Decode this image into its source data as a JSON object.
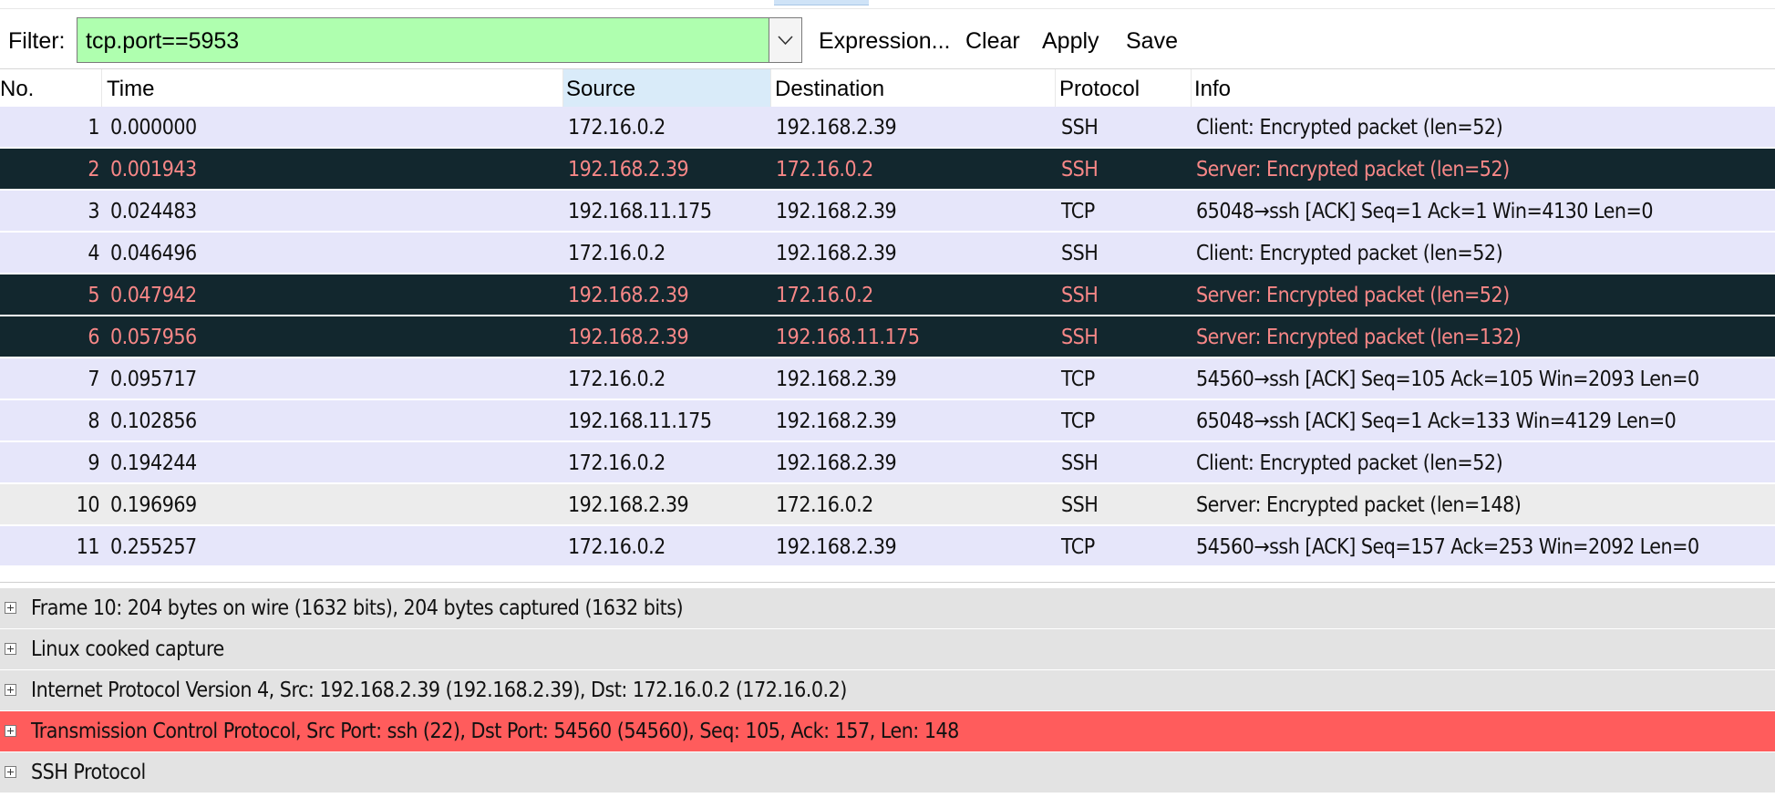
{
  "filter_bar": {
    "label": "Filter:",
    "value": "tcp.port==5953",
    "expression_label": "Expression...",
    "clear_label": "Clear",
    "apply_label": "Apply",
    "save_label": "Save",
    "valid_color": "#afffaf"
  },
  "packet_list": {
    "columns": [
      "No.",
      "Time",
      "Source",
      "Destination",
      "Protocol",
      "Info"
    ],
    "rows": [
      {
        "no": "1",
        "time": "0.000000",
        "source": "172.16.0.2",
        "destination": "192.168.2.39",
        "protocol": "SSH",
        "info": "Client: Encrypted packet (len=52)"
      },
      {
        "no": "2",
        "time": "0.001943",
        "source": "192.168.2.39",
        "destination": "172.16.0.2",
        "protocol": "SSH",
        "info": "Server: Encrypted packet (len=52)"
      },
      {
        "no": "3",
        "time": "0.024483",
        "source": "192.168.11.175",
        "destination": "192.168.2.39",
        "protocol": "TCP",
        "info": "65048→ssh [ACK] Seq=1 Ack=1 Win=4130 Len=0"
      },
      {
        "no": "4",
        "time": "0.046496",
        "source": "172.16.0.2",
        "destination": "192.168.2.39",
        "protocol": "SSH",
        "info": "Client: Encrypted packet (len=52)"
      },
      {
        "no": "5",
        "time": "0.047942",
        "source": "192.168.2.39",
        "destination": "172.16.0.2",
        "protocol": "SSH",
        "info": "Server: Encrypted packet (len=52)"
      },
      {
        "no": "6",
        "time": "0.057956",
        "source": "192.168.2.39",
        "destination": "192.168.11.175",
        "protocol": "SSH",
        "info": "Server: Encrypted packet (len=132)"
      },
      {
        "no": "7",
        "time": "0.095717",
        "source": "172.16.0.2",
        "destination": "192.168.2.39",
        "protocol": "TCP",
        "info": "54560→ssh [ACK] Seq=105 Ack=105 Win=2093 Len=0"
      },
      {
        "no": "8",
        "time": "0.102856",
        "source": "192.168.11.175",
        "destination": "192.168.2.39",
        "protocol": "TCP",
        "info": "65048→ssh [ACK] Seq=1 Ack=133 Win=4129 Len=0"
      },
      {
        "no": "9",
        "time": "0.194244",
        "source": "172.16.0.2",
        "destination": "192.168.2.39",
        "protocol": "SSH",
        "info": "Client: Encrypted packet (len=52)"
      },
      {
        "no": "10",
        "time": "0.196969",
        "source": "192.168.2.39",
        "destination": "172.16.0.2",
        "protocol": "SSH",
        "info": "Server: Encrypted packet (len=148)"
      },
      {
        "no": "11",
        "time": "0.255257",
        "source": "172.16.0.2",
        "destination": "192.168.2.39",
        "protocol": "TCP",
        "info": "54560→ssh [ACK] Seq=157 Ack=253 Win=2092 Len=0"
      }
    ]
  },
  "packet_details": [
    {
      "text": "Frame 10: 204 bytes on wire (1632 bits), 204 bytes captured (1632 bits)"
    },
    {
      "text": "Linux cooked capture"
    },
    {
      "text": "Internet Protocol Version 4, Src: 192.168.2.39 (192.168.2.39), Dst: 172.16.0.2 (172.16.0.2)"
    },
    {
      "text": "Transmission Control Protocol, Src Port: ssh (22), Dst Port: 54560 (54560), Seq: 105, Ack: 157, Len: 148"
    },
    {
      "text": "SSH Protocol"
    }
  ],
  "colors": {
    "row_light": "#e6e6fa",
    "row_dark": "#12272e",
    "row_dark_text": "#f78787",
    "row_selected": "#ececec",
    "detail_bg": "#e3e3e3",
    "detail_highlight": "#ff5c5c"
  }
}
